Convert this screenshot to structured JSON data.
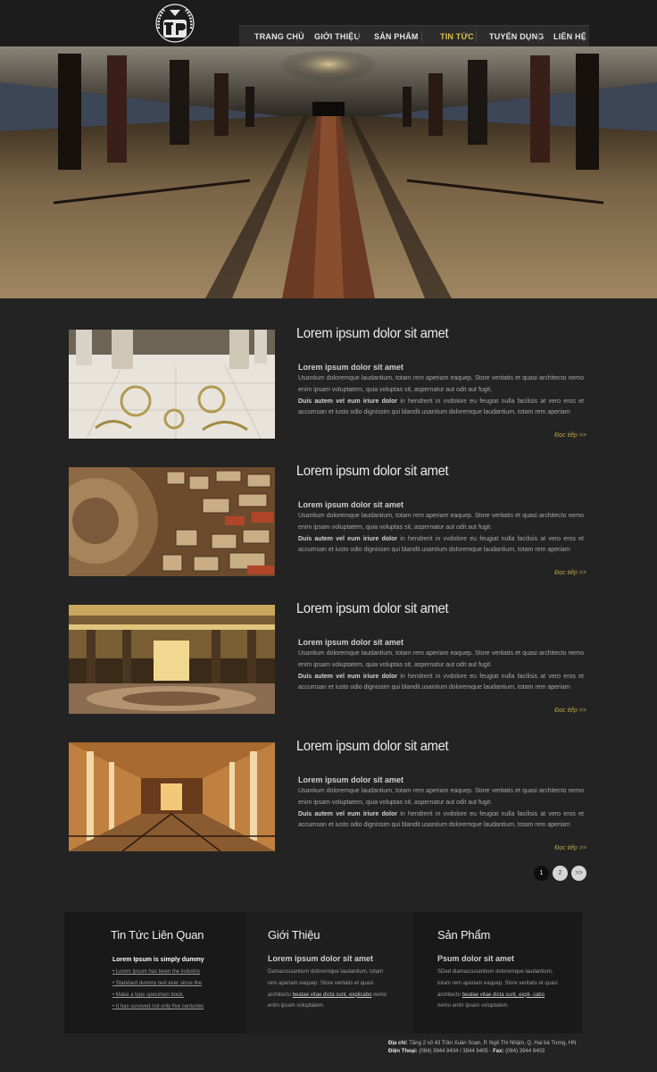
{
  "nav": {
    "items": [
      {
        "label": "Trang chủ",
        "active": false
      },
      {
        "label": "Giới thiệu",
        "active": false
      },
      {
        "label": "Sản phẩm",
        "active": false
      },
      {
        "label": "Tin tức",
        "active": true
      },
      {
        "label": "Tuyển dụng",
        "active": false
      },
      {
        "label": "Liên hệ",
        "active": false
      }
    ]
  },
  "articles": [
    {
      "title": "Lorem ipsum dolor sit amet",
      "subtitle": "Lorem ipsum dolor sit amet",
      "body1": "Usantium doloremque laudantium, totam rem aperiam eaquep. Store veritatis et quasi architecto nemo enim ipsam voluptatem, quia voluptas sit, aspernatur aut odit aut fugit.",
      "bold": "Duis autem vel eum iriure dolor",
      "body2": " in hendrerit in vvdolore eu feugiat nulla facilisis at vero eros et accumsan et iusto odio dignissim qui blandit.usantium doloremque laudantium, totam rem aperiam",
      "more": "Đọc tiếp >>"
    },
    {
      "title": "Lorem ipsum dolor sit amet",
      "subtitle": "Lorem ipsum dolor sit amet",
      "body1": "Usantium doloremque laudantium, totam rem aperiam eaquep. Store veritatis et quasi architecto nemo enim ipsam voluptatem, quia voluptas sit, aspernatur aut odit aut fugit.",
      "bold": "Duis autem vel eum iriure dolor",
      "body2": " in hendrerit in vvdolore eu feugiat nulla facilisis at vero eros et accumsan et iusto odio dignissim qui blandit.usantium doloremque laudantium, totam rem aperiam",
      "more": "Đọc tiếp >>"
    },
    {
      "title": "Lorem ipsum dolor sit amet",
      "subtitle": "Lorem ipsum dolor sit amet",
      "body1": "Usantium doloremque laudantium, totam rem aperiam eaquep. Store veritatis et quasi architecto nemo enim ipsam voluptatem, quia voluptas sit, aspernatur aut odit aut fugit.",
      "bold": "Duis autem vel eum iriure dolor",
      "body2": " in hendrerit in vvdolore eu feugiat nulla facilisis at vero eros et accumsan et iusto odio dignissim qui blandit.usantium doloremque laudantium, totam rem aperiam",
      "more": "Đọc tiếp >>"
    },
    {
      "title": "Lorem ipsum dolor sit amet",
      "subtitle": "Lorem ipsum dolor sit amet",
      "body1": "Usantium doloremque laudantium, totam rem aperiam eaquep. Store veritatis et quasi architecto nemo enim ipsam voluptatem, quia voluptas sit, aspernatur aut odit aut fugit.",
      "bold": "Duis autem vel eum iriure dolor",
      "body2": " in hendrerit in vvdolore eu feugiat nulla facilisis at vero eros et accumsan et iusto odio dignissim qui blandit.usantium doloremque laudantium, totam rem aperiam",
      "more": "Đọc tiếp >>"
    }
  ],
  "pagination": {
    "pages": [
      "1",
      "2",
      ">>"
    ],
    "current": "1"
  },
  "footer": {
    "news": {
      "heading": "Tin Tức Liên Quan",
      "lead": "Lorem Ipsum is simply dummy",
      "links": [
        "Lorem Ipsum has been the industry",
        "Standard dummy text ever since the",
        "Make a type specimen book.",
        "It has survived not only five centuries"
      ]
    },
    "about": {
      "heading": "Giới Thiệu",
      "subtitle": "Lorem ipsum dolor sit amet",
      "text1": "Damaccusantium doloremque laudantium, totam rem aperiam eaquep. Store veritatis et quasi architecto ",
      "underline": "beatae vitae dicta sunt, explicabo",
      "text2": " nemo enim ipsam voluptatem."
    },
    "products": {
      "heading": "Sản Phẩm",
      "subtitle": "Psum dolor sit amet",
      "text1": "SDed diamaccusantium doloremque laudantium, totam rem aperiam eaquep. Store veritatis et quasi architecto ",
      "underline": "beatae vitae dicta sunt, expli- cabo",
      "text2": " nemo enim ipsam voluptatem."
    }
  },
  "contact": {
    "address_label": "Địa chỉ:",
    "address": " Tầng 2 số 43 Trần Xuân Soạn, P. Ngô Thì Nhậm, Q. Hai bà Trưng, HN",
    "phone_label": "Điện Thoại:",
    "phone": " (084) 3944 9404 / 3944 9405  -  ",
    "fax_label": "Fax:",
    "fax": " (084) 3944 9403"
  },
  "colors": {
    "background": "#232323",
    "accent": "#d8c24a",
    "more_link": "#b9a64a"
  }
}
